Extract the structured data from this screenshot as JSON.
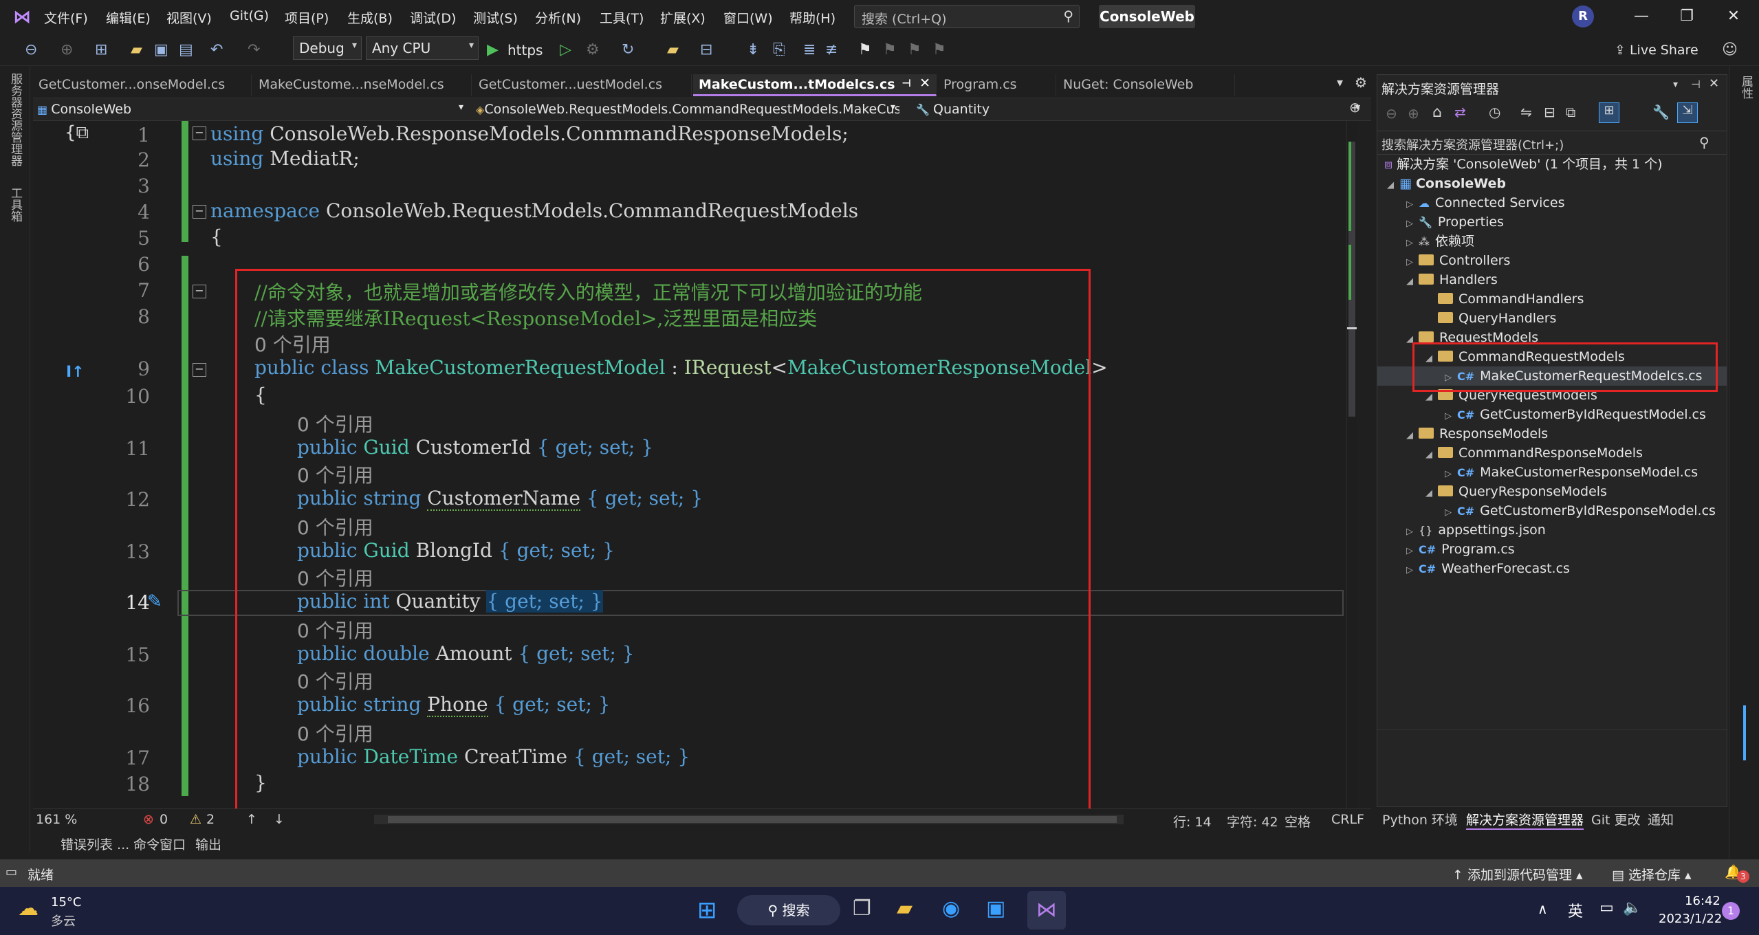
{
  "menu": {
    "items": [
      "文件(F)",
      "编辑(E)",
      "视图(V)",
      "Git(G)",
      "项目(P)",
      "生成(B)",
      "调试(D)",
      "测试(S)",
      "分析(N)",
      "工具(T)",
      "扩展(X)",
      "窗口(W)",
      "帮助(H)"
    ],
    "search_placeholder": "搜索 (Ctrl+Q)",
    "title": "ConsoleWeb",
    "avatar": "R",
    "live_share": "Live Share"
  },
  "toolbar": {
    "config": "Debug",
    "platform": "Any CPU",
    "run_target": "https"
  },
  "left_panel": {
    "server_explorer": "服务器资源管理器",
    "toolbox": "工具箱"
  },
  "tabs": [
    "GetCustomer...onseModel.cs",
    "MakeCustome...nseModel.cs",
    "GetCustomer...uestModel.cs",
    "MakeCustom...tModelcs.cs",
    "Program.cs",
    "NuGet: ConsoleWeb"
  ],
  "navbar": {
    "project": "ConsoleWeb",
    "type": "ConsoleWeb.RequestModels.CommandRequestModels.MakeCusto",
    "member": "Quantity"
  },
  "code": {
    "line_numbers": [
      "1",
      "2",
      "3",
      "4",
      "5",
      "6",
      "7",
      "8",
      "9",
      "10",
      "11",
      "12",
      "13",
      "14",
      "15",
      "16",
      "17",
      "18"
    ],
    "refs": "0 个引用",
    "l1_kw": "using",
    "l1_rest": " ConsoleWeb.ResponseModels.ConmmandResponseModels;",
    "l2_kw": "using",
    "l2_rest": " MediatR;",
    "l4_kw": "namespace",
    "l4_rest": " ConsoleWeb.RequestModels.CommandRequestModels",
    "open_brace": "{",
    "close_brace": "}",
    "c1": "//命令对象，也就是增加或者修改传入的模型，正常情况下可以增加验证的功能",
    "c2": "//请求需要继承IRequest<ResponseModel>,泛型里面是相应类",
    "class_kw": "public class",
    "class_name": "MakeCustomerRequestModel",
    "class_colon": " : ",
    "iface": "IRequest",
    "lt": "<",
    "generic": "MakeCustomerResponseModel",
    "gt": ">",
    "public": "public",
    "getset": "{ get; set; }",
    "props": [
      {
        "type": "Guid",
        "name": "CustomerId"
      },
      {
        "type": "string",
        "name": "CustomerName"
      },
      {
        "type": "Guid",
        "name": "BlongId"
      },
      {
        "type": "int",
        "name": "Quantity"
      },
      {
        "type": "double",
        "name": "Amount"
      },
      {
        "type": "string",
        "name": "Phone"
      },
      {
        "type": "DateTime",
        "name": "CreatTime"
      }
    ]
  },
  "status_row": {
    "zoom": "161 %",
    "errors": "0",
    "warnings": "2",
    "line": "行: 14",
    "col": "字符: 42",
    "spaces": "空格",
    "eol": "CRLF"
  },
  "bottom_tabs": [
    "错误列表 ...",
    "命令窗口",
    "输出"
  ],
  "solution_explorer": {
    "title": "解决方案资源管理器",
    "search_placeholder": "搜索解决方案资源管理器(Ctrl+;)",
    "solution": "解决方案 'ConsoleWeb' (1 个项目，共 1 个)",
    "project": "ConsoleWeb",
    "items": [
      {
        "label": "Connected Services",
        "depth": 1,
        "icon": "cloud",
        "tw": "▷"
      },
      {
        "label": "Properties",
        "depth": 1,
        "icon": "wrench",
        "tw": "▷"
      },
      {
        "label": "依赖项",
        "depth": 1,
        "icon": "deps",
        "tw": "▷"
      },
      {
        "label": "Controllers",
        "depth": 1,
        "icon": "folder",
        "tw": "▷"
      },
      {
        "label": "Handlers",
        "depth": 1,
        "icon": "folder",
        "tw": "◢"
      },
      {
        "label": "CommandHandlers",
        "depth": 2,
        "icon": "folder",
        "tw": ""
      },
      {
        "label": "QueryHandlers",
        "depth": 2,
        "icon": "folder",
        "tw": ""
      },
      {
        "label": "RequestModels",
        "depth": 1,
        "icon": "folder",
        "tw": "◢"
      },
      {
        "label": "CommandRequestModels",
        "depth": 2,
        "icon": "folder",
        "tw": "◢"
      },
      {
        "label": "MakeCustomerRequestModelcs.cs",
        "depth": 3,
        "icon": "cs",
        "tw": "▷"
      },
      {
        "label": "QueryRequestModels",
        "depth": 2,
        "icon": "folder",
        "tw": "◢"
      },
      {
        "label": "GetCustomerByIdRequestModel.cs",
        "depth": 3,
        "icon": "cs",
        "tw": "▷"
      },
      {
        "label": "ResponseModels",
        "depth": 1,
        "icon": "folder",
        "tw": "◢"
      },
      {
        "label": "ConmmandResponseModels",
        "depth": 2,
        "icon": "folder",
        "tw": "◢"
      },
      {
        "label": "MakeCustomerResponseModel.cs",
        "depth": 3,
        "icon": "cs",
        "tw": "▷"
      },
      {
        "label": "QueryResponseModels",
        "depth": 2,
        "icon": "folder",
        "tw": "◢"
      },
      {
        "label": "GetCustomerByIdResponseModel.cs",
        "depth": 3,
        "icon": "cs",
        "tw": "▷"
      },
      {
        "label": "appsettings.json",
        "depth": 1,
        "icon": "json",
        "tw": "▷"
      },
      {
        "label": "Program.cs",
        "depth": 1,
        "icon": "cs",
        "tw": "▷"
      },
      {
        "label": "WeatherForecast.cs",
        "depth": 1,
        "icon": "cs",
        "tw": "▷"
      }
    ],
    "tabs": [
      "Python 环境",
      "解决方案资源管理器",
      "Git 更改",
      "通知"
    ]
  },
  "right_strip": "属性",
  "statusbar": {
    "ready": "就绪",
    "add_source": "添加到源代码管理",
    "select_repo": "选择仓库",
    "notif_count": "3"
  },
  "taskbar": {
    "temp": "15°C",
    "weather": "多云",
    "search": "搜索",
    "ime": "英",
    "time": "16:42",
    "date": "2023/1/22",
    "badge": "1"
  }
}
